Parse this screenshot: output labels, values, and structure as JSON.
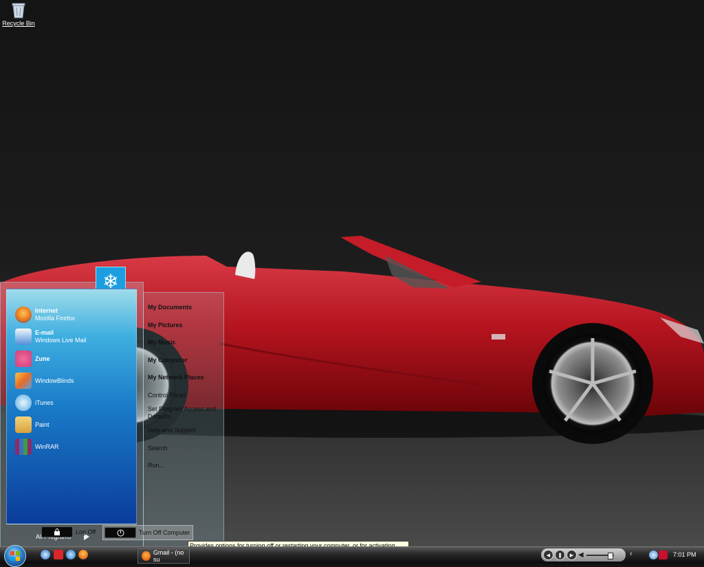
{
  "desktop": {
    "icons": [
      {
        "label": "Recycle Bin",
        "icon": "recycle-bin-icon"
      }
    ]
  },
  "start_menu": {
    "user_picture": "snowflake-icon",
    "pinned": [
      {
        "title": "Internet",
        "subtitle": "Mozilla Firefox",
        "icon": "firefox-icon",
        "color": "#e8761c"
      },
      {
        "title": "E-mail",
        "subtitle": "Windows Live Mail",
        "icon": "mail-icon",
        "color": "#4f90d9"
      }
    ],
    "recent": [
      {
        "label": "Zune",
        "icon": "zune-icon",
        "bold": true,
        "color": "#d43c7a"
      },
      {
        "label": "WindowBlinds",
        "icon": "windowblinds-icon",
        "bold": false,
        "color": "#e96b28"
      },
      {
        "label": "iTunes",
        "icon": "itunes-icon",
        "bold": false,
        "color": "#57a9e0"
      },
      {
        "label": "Paint",
        "icon": "paint-icon",
        "bold": false,
        "color": "#d8a23c"
      },
      {
        "label": "WinRAR",
        "icon": "winrar-icon",
        "bold": false,
        "color": "#8b2b6a"
      }
    ],
    "all_programs": "All Programs",
    "places": [
      {
        "label": "My Documents",
        "bold": true
      },
      {
        "label": "My Pictures",
        "bold": true
      },
      {
        "label": "My Music",
        "bold": true
      },
      {
        "label": "My Computer",
        "bold": true
      },
      {
        "label": "My Network Places",
        "bold": true
      },
      {
        "label": "Control Panel",
        "bold": false
      },
      {
        "label": "Set Program Access and Defaults",
        "bold": false
      },
      {
        "label": "Help and Support",
        "bold": false
      },
      {
        "label": "Search",
        "bold": false
      },
      {
        "label": "Run...",
        "bold": false
      }
    ],
    "log_off": "Log Off",
    "turn_off": "Turn Off Computer"
  },
  "tooltip": {
    "text": "Provides options for turning off or restarting your computer, or for activating Stand By or Hibernate modes."
  },
  "taskbar": {
    "start_button": "windows-start-orb",
    "quick_launch": [
      "media-player-icon",
      "red-app-icon",
      "ie-icon",
      "firefox-icon"
    ],
    "tasks": [
      {
        "label": "Gmail - (no su",
        "icon": "firefox-icon"
      }
    ],
    "media_controls": [
      "rewind-icon",
      "pause-icon",
      "forward-icon",
      "volume-icon"
    ],
    "volume_level": 0.85,
    "tray_icons": [
      "network-icon",
      "mcafee-icon"
    ],
    "clock": "7:01 PM"
  }
}
